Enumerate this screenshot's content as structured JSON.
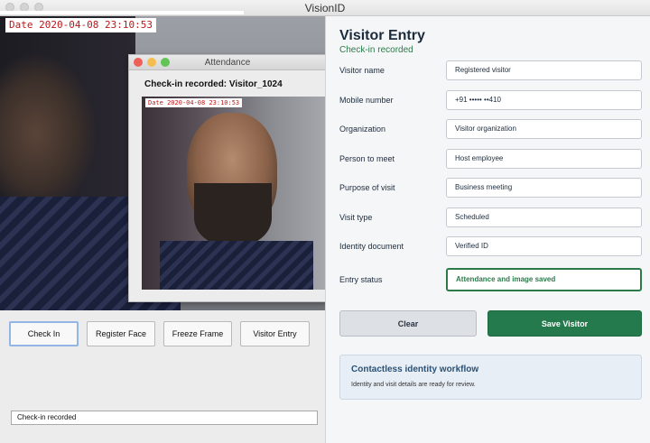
{
  "window": {
    "title": "VisionID"
  },
  "camera": {
    "timestamp": "Date 2020-04-08 23:10:53"
  },
  "attendance_popup": {
    "title": "Attendance",
    "message": "Check-in recorded: Visitor_1024",
    "timestamp": "Date 2020-04-08 23:10:53"
  },
  "actions": {
    "check_in": "Check In",
    "register_face": "Register Face",
    "freeze_frame": "Freeze Frame",
    "visitor_entry": "Visitor Entry"
  },
  "status_bar": {
    "text": "Check-in recorded"
  },
  "visitor_entry": {
    "title": "Visitor Entry",
    "subtitle": "Check-in recorded",
    "fields": [
      {
        "label": "Visitor name",
        "value": "Registered visitor"
      },
      {
        "label": "Mobile number",
        "value": "+91 ••••• ••410"
      },
      {
        "label": "Organization",
        "value": "Visitor organization"
      },
      {
        "label": "Person to meet",
        "value": "Host employee"
      },
      {
        "label": "Purpose of visit",
        "value": "Business meeting"
      },
      {
        "label": "Visit type",
        "value": "Scheduled"
      },
      {
        "label": "Identity document",
        "value": "Verified ID"
      },
      {
        "label": "Entry status",
        "value": "Attendance and image saved"
      }
    ],
    "clear_label": "Clear",
    "save_label": "Save Visitor",
    "info_card": {
      "title": "Contactless identity workflow",
      "body": "Identity and visit details are ready for review."
    }
  },
  "colors": {
    "accent_green": "#247a4c",
    "subtitle_green": "#2b7a4a",
    "timestamp_red": "#c01515",
    "info_title": "#2a5276"
  }
}
